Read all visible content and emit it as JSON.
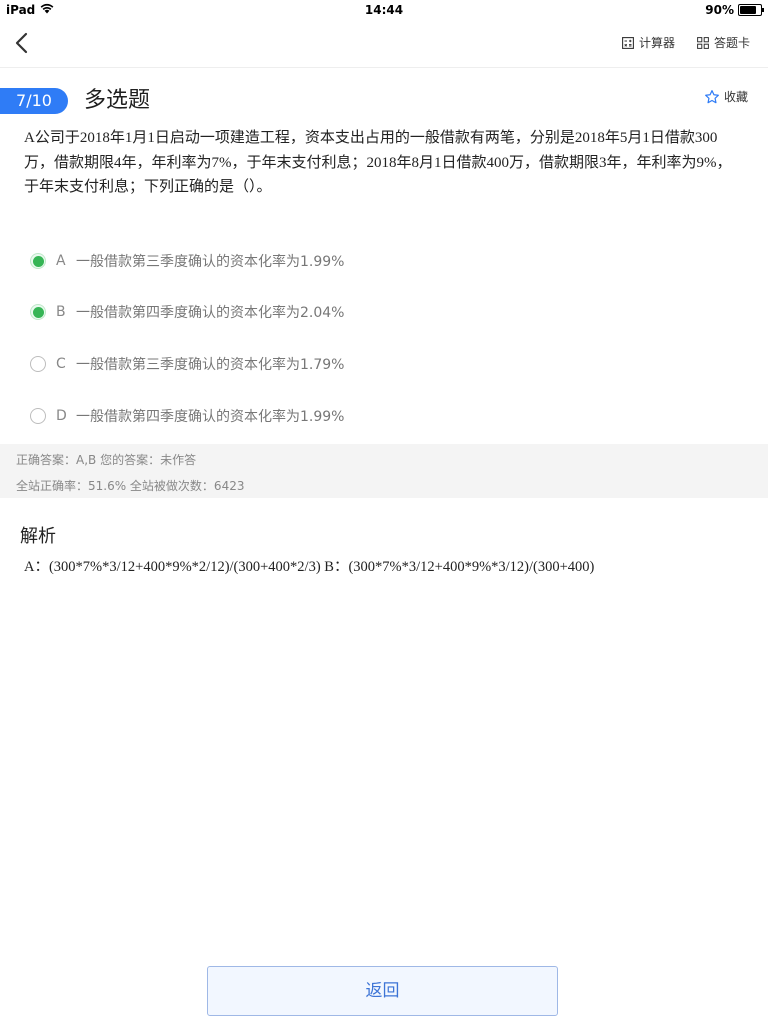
{
  "status_bar": {
    "device": "iPad",
    "time": "14:44",
    "battery_percent": "90%",
    "battery_level": 0.9
  },
  "toolbar": {
    "calculator_label": "计算器",
    "answer_card_label": "答题卡"
  },
  "question": {
    "progress": "7/10",
    "type": "多选题",
    "favorite_label": "收藏",
    "stem": "A公司于2018年1月1日启动一项建造工程，资本支出占用的一般借款有两笔，分别是2018年5月1日借款300万，借款期限4年，年利率为7%，于年末支付利息；2018年8月1日借款400万，借款期限3年，年利率为9%，于年末支付利息；下列正确的是（）。"
  },
  "options": [
    {
      "letter": "A",
      "text": "一般借款第三季度确认的资本化率为1.99%",
      "selected": true
    },
    {
      "letter": "B",
      "text": "一般借款第四季度确认的资本化率为2.04%",
      "selected": true
    },
    {
      "letter": "C",
      "text": "一般借款第三季度确认的资本化率为1.79%",
      "selected": false
    },
    {
      "letter": "D",
      "text": "一般借款第四季度确认的资本化率为1.99%",
      "selected": false
    }
  ],
  "answer_info": {
    "line1": "正确答案：A,B 您的答案：未作答",
    "line2": "全站正确率：51.6% 全站被做次数：6423"
  },
  "analysis": {
    "title": "解析",
    "text": "A：(300*7%*3/12+400*9%*2/12)/(300+400*2/3) B：(300*7%*3/12+400*9%*3/12)/(300+400)"
  },
  "footer": {
    "return_label": "返回"
  },
  "colors": {
    "accent": "#2f7cf6",
    "selected_green": "#36b555",
    "return_text": "#3d74d6"
  }
}
